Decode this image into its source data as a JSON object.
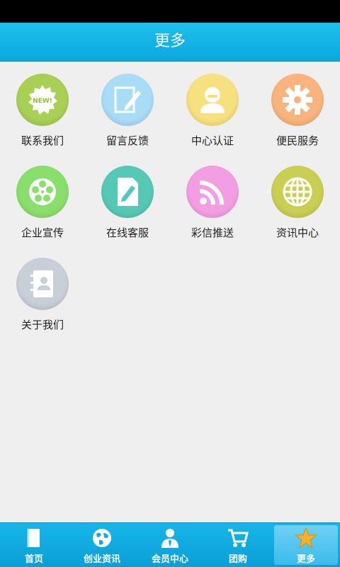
{
  "header": {
    "title": "更多"
  },
  "colors": {
    "header": "#12b3e6",
    "contact": "#9fcf4b",
    "feedback": "#a8dcf8",
    "verify": "#f7e181",
    "services": "#f7b27a",
    "promo": "#86df68",
    "service_online": "#52c7b5",
    "mms": "#f29be0",
    "news": "#c8cf4e",
    "about": "#c7ced6"
  },
  "menu": {
    "items": [
      {
        "label": "联系我们",
        "icon": "new-badge-icon"
      },
      {
        "label": "留言反馈",
        "icon": "edit-icon"
      },
      {
        "label": "中心认证",
        "icon": "user-icon"
      },
      {
        "label": "便民服务",
        "icon": "gear-icon"
      },
      {
        "label": "企业宣传",
        "icon": "film-reel-icon"
      },
      {
        "label": "在线客服",
        "icon": "document-edit-icon"
      },
      {
        "label": "彩信推送",
        "icon": "rss-icon"
      },
      {
        "label": "资讯中心",
        "icon": "globe-icon"
      },
      {
        "label": "关于我们",
        "icon": "address-book-icon"
      }
    ],
    "badge_text": "NEW!"
  },
  "tabbar": {
    "tabs": [
      {
        "label": "首页",
        "icon": "book-icon"
      },
      {
        "label": "创业资讯",
        "icon": "globe-icon"
      },
      {
        "label": "会员中心",
        "icon": "member-icon"
      },
      {
        "label": "团购",
        "icon": "cart-icon"
      },
      {
        "label": "更多",
        "icon": "star-icon",
        "active": true
      }
    ]
  }
}
